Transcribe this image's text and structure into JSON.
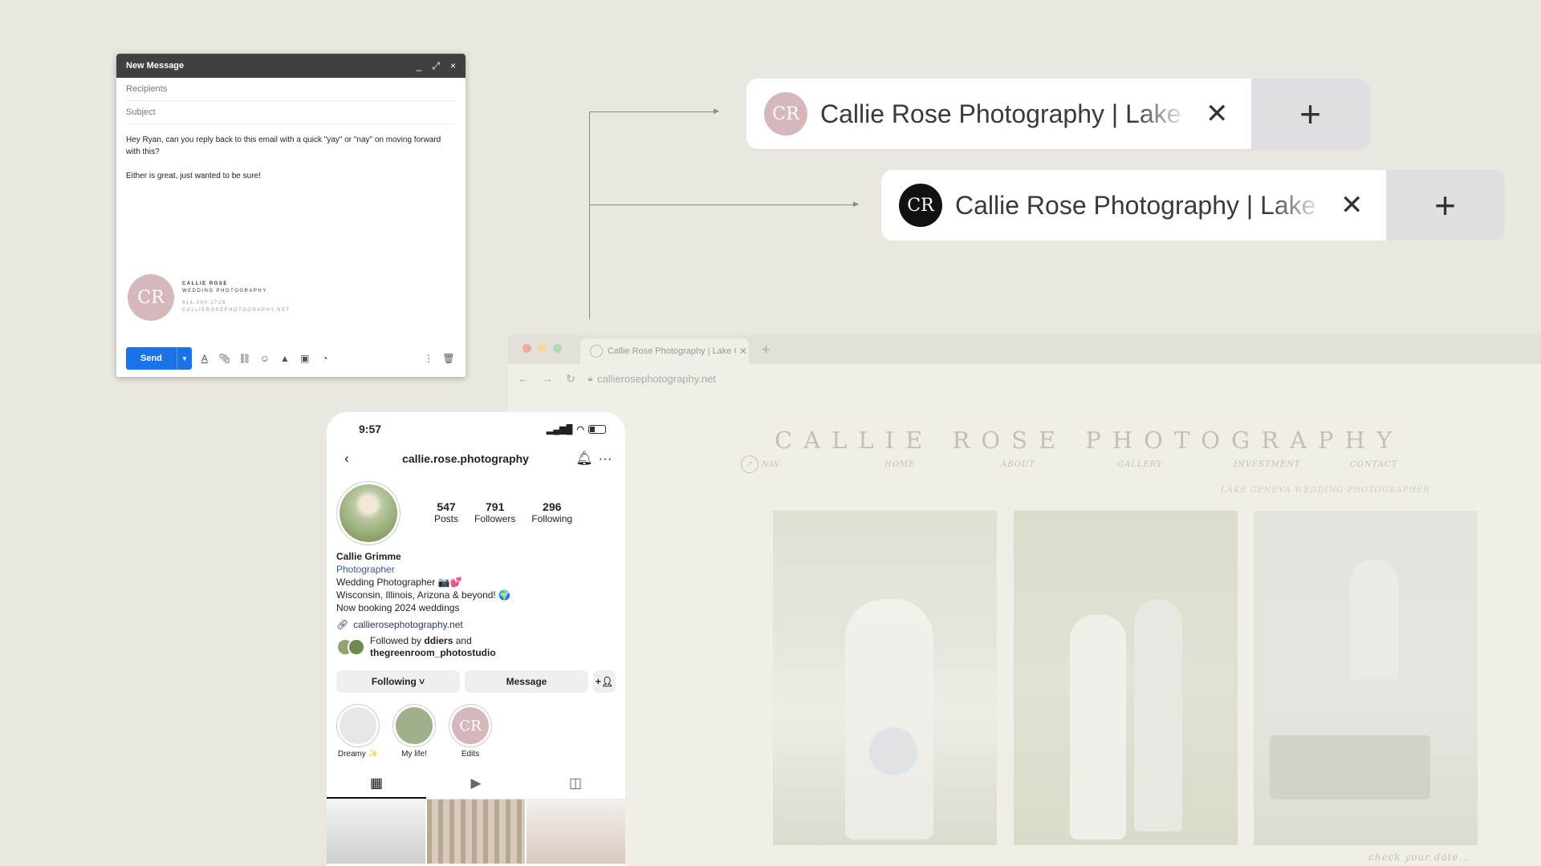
{
  "email": {
    "title": "New Message",
    "controls": {
      "minimize": "_",
      "expand": "⤢",
      "close": "×"
    },
    "recipients_placeholder": "Recipients",
    "subject_placeholder": "Subject",
    "body_line1": "Hey Ryan, can you reply back to this email with a quick \"yay\" or \"nay\" on moving forward with this?",
    "body_line2": "Either is great, just wanted to be sure!",
    "signature": {
      "logo": "CR",
      "name": "CALLIE ROSE",
      "company": "WEDDING PHOTOGRAPHY",
      "phone": "414.380.1729",
      "website": "CALLIEROSEPHOTOGRAPHY.NET"
    },
    "send_label": "Send"
  },
  "tabs_preview": [
    {
      "favicon": "CR",
      "title": "Callie Rose Photography | Lake Geneva Wedding Photographer",
      "close": "✕",
      "plus": "+",
      "favicon_color": "#d6b7bb"
    },
    {
      "favicon": "CR",
      "title": "Callie Rose Photography | Lake Geneva Wedding Photographer",
      "close": "✕",
      "plus": "+",
      "favicon_color": "#111111"
    }
  ],
  "browser": {
    "tab_title": "Callie Rose Photography | Lake Geneva",
    "tab_close": "✕",
    "new_tab": "+",
    "url": "callierosephotography.net",
    "site": {
      "title": "CALLIE ROSE PHOTOGRAPHY",
      "nav_label": "NAV",
      "nav": [
        "HOME",
        "ABOUT",
        "GALLERY",
        "INVESTMENT",
        "CONTACT"
      ],
      "tagline": "LAKE GENEVA WEDDING PHOTOGRAPHER",
      "cta": "check your date..."
    }
  },
  "phone": {
    "time": "9:57",
    "handle": "callie.rose.photography",
    "posts": "547",
    "posts_label": "Posts",
    "followers": "791",
    "followers_label": "Followers",
    "following": "296",
    "following_label": "Following",
    "name": "Callie Grimme",
    "category": "Photographer",
    "bio_line1": "Wedding Photographer 📷💕",
    "bio_line2": "Wisconsin, Illinois, Arizona & beyond! 🌍",
    "bio_line3": "Now booking 2024 weddings",
    "link": "callierosephotography.net",
    "followed_by_prefix": "Followed by",
    "followed_by_1": "ddiers",
    "followed_by_and": "and",
    "followed_by_2": "thegreenroom_photostudio",
    "following_btn": "Following ˅",
    "message_btn": "Message",
    "highlights": [
      {
        "label": "Dreamy ✨"
      },
      {
        "label": "My life!"
      },
      {
        "label": "Edits",
        "logo": "CR"
      }
    ]
  }
}
